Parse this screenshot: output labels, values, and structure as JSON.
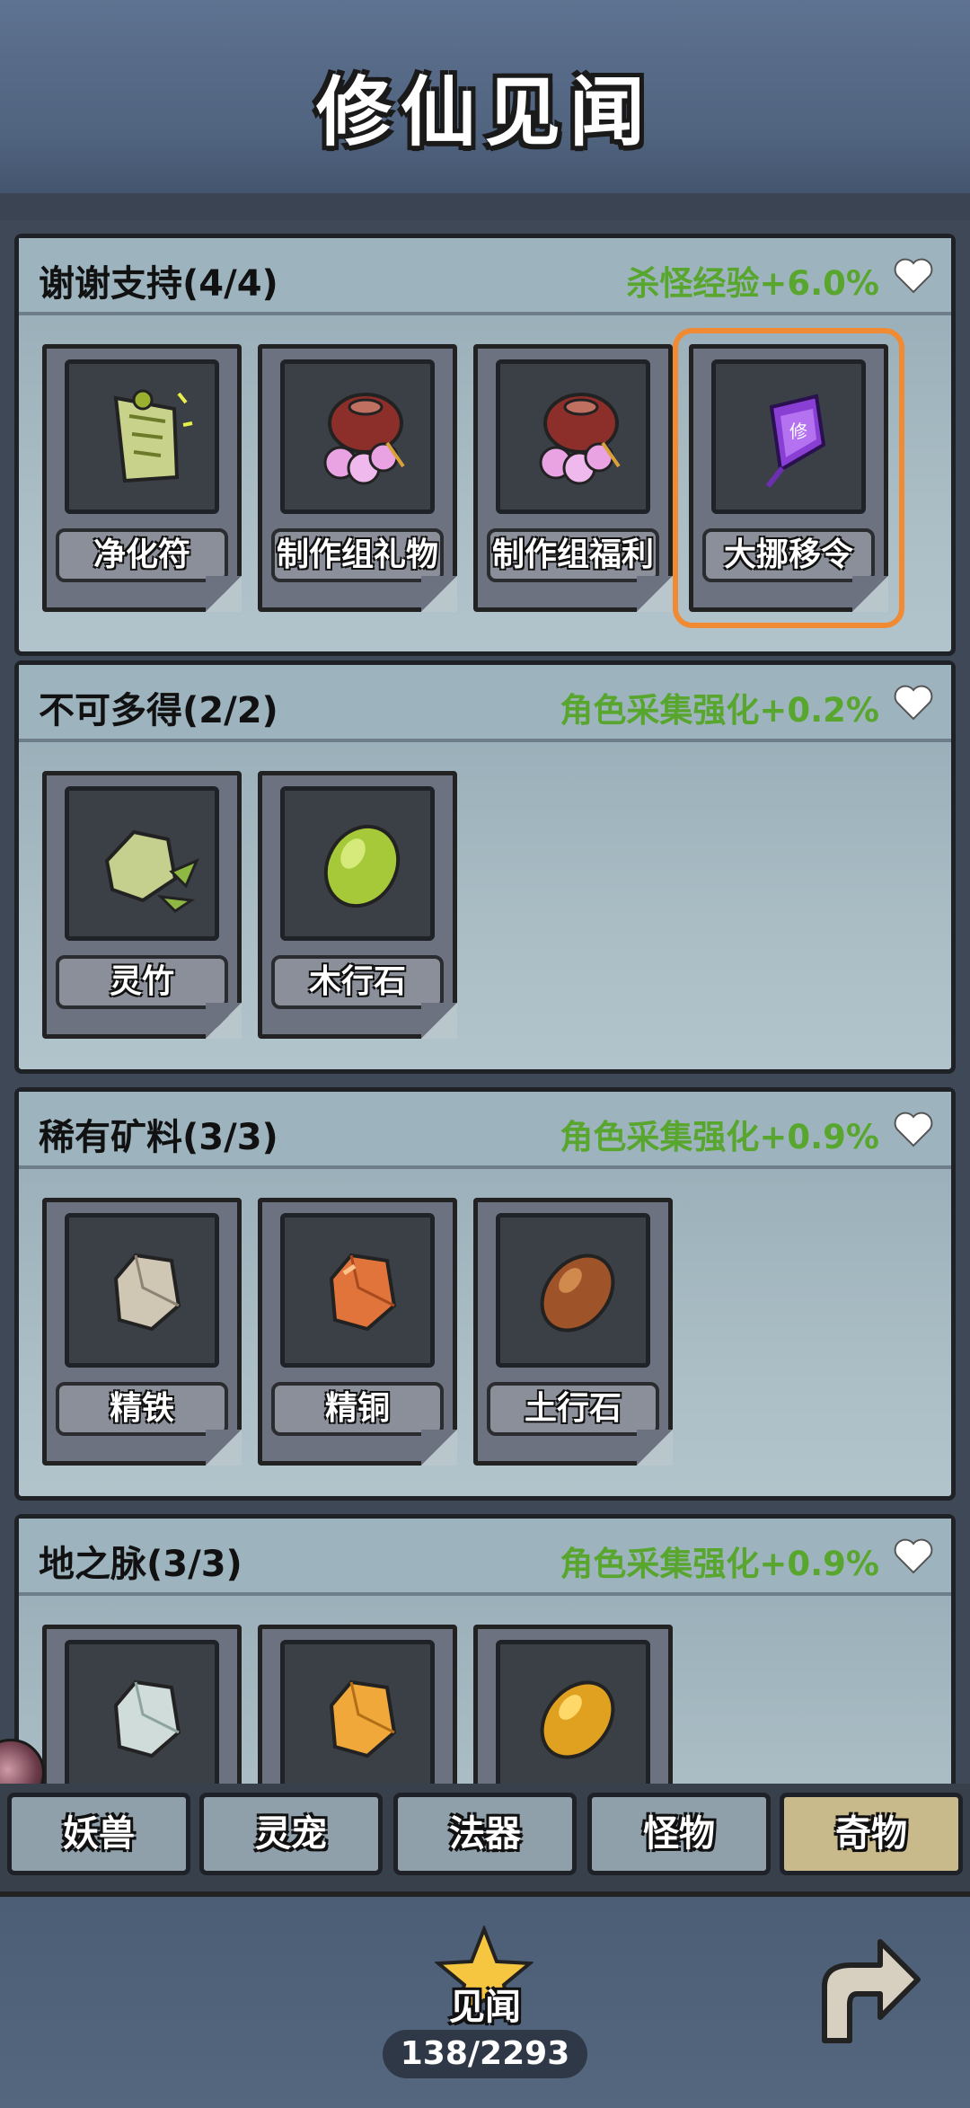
{
  "header": {
    "title": "修仙见闻"
  },
  "sections": [
    {
      "title": "谢谢支持(4/4)",
      "bonus": "杀怪经验+6.0%",
      "items": [
        {
          "label": "净化符",
          "icon": "talisman-icon"
        },
        {
          "label": "制作组礼物",
          "icon": "gift-bag-icon"
        },
        {
          "label": "制作组福利",
          "icon": "gift-bag-icon"
        },
        {
          "label": "大挪移令",
          "icon": "purple-token-icon"
        }
      ]
    },
    {
      "title": "不可多得(2/2)",
      "bonus": "角色采集强化+0.2%",
      "items": [
        {
          "label": "灵竹",
          "icon": "bamboo-stone-icon"
        },
        {
          "label": "木行石",
          "icon": "green-stone-icon"
        }
      ]
    },
    {
      "title": "稀有矿料(3/3)",
      "bonus": "角色采集强化+0.9%",
      "items": [
        {
          "label": "精铁",
          "icon": "iron-ore-icon"
        },
        {
          "label": "精铜",
          "icon": "copper-ore-icon"
        },
        {
          "label": "土行石",
          "icon": "earth-stone-icon"
        }
      ]
    },
    {
      "title": "地之脉(3/3)",
      "bonus": "角色采集强化+0.9%",
      "items": [
        {
          "label": "",
          "icon": "pale-ore-icon"
        },
        {
          "label": "",
          "icon": "gold-ore-icon"
        },
        {
          "label": "",
          "icon": "gold-stone-icon"
        }
      ]
    }
  ],
  "tabs": [
    {
      "label": "妖兽",
      "active": false
    },
    {
      "label": "灵宠",
      "active": false
    },
    {
      "label": "法器",
      "active": false
    },
    {
      "label": "怪物",
      "active": false
    },
    {
      "label": "奇物",
      "active": true
    }
  ],
  "footer": {
    "star_label": "见闻",
    "progress": "138/2293"
  },
  "colors": {
    "bonus_green": "#58a62e",
    "highlight_orange": "#f08a33",
    "active_tab": "#c9ba8c"
  }
}
